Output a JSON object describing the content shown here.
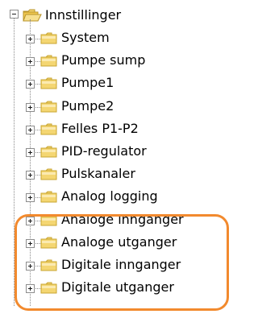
{
  "root": {
    "label": "Innstillinger",
    "expanded": true,
    "icon": "open-folder-icon"
  },
  "children": [
    {
      "label": "System",
      "expanded": false,
      "icon": "folder-icon"
    },
    {
      "label": "Pumpe sump",
      "expanded": false,
      "icon": "folder-icon"
    },
    {
      "label": "Pumpe1",
      "expanded": false,
      "icon": "folder-icon"
    },
    {
      "label": "Pumpe2",
      "expanded": false,
      "icon": "folder-icon"
    },
    {
      "label": "Felles P1-P2",
      "expanded": false,
      "icon": "folder-icon"
    },
    {
      "label": "PID-regulator",
      "expanded": false,
      "icon": "folder-icon"
    },
    {
      "label": "Pulskanaler",
      "expanded": false,
      "icon": "folder-icon"
    },
    {
      "label": "Analog logging",
      "expanded": false,
      "icon": "folder-icon"
    },
    {
      "label": "Analoge innganger",
      "expanded": false,
      "icon": "folder-icon"
    },
    {
      "label": "Analoge utganger",
      "expanded": false,
      "icon": "folder-icon"
    },
    {
      "label": "Digitale innganger",
      "expanded": false,
      "icon": "folder-icon"
    },
    {
      "label": "Digitale utganger",
      "expanded": false,
      "icon": "folder-icon"
    }
  ],
  "colors": {
    "highlight": "#f28a2e",
    "folder_fill": "#f4d672",
    "folder_edge": "#c9a531"
  }
}
